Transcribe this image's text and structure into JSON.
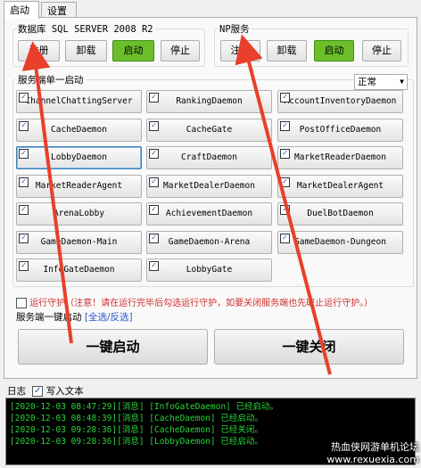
{
  "tabs": [
    "启动",
    "设置"
  ],
  "db_group": {
    "title": "数据库 SQL SERVER 2008 R2",
    "buttons": [
      "注册",
      "卸载",
      "启动",
      "停止"
    ]
  },
  "np_group": {
    "title": "NP服务",
    "buttons": [
      "注册",
      "卸载",
      "启动",
      "停止"
    ]
  },
  "services_group": {
    "title": "服务端单一启动",
    "mode_select": "正常",
    "services": [
      "ChannelChattingServer",
      "RankingDaemon",
      "AccountInventoryDaemon",
      "CacheDaemon",
      "CacheGate",
      "PostOfficeDaemon",
      "LobbyDaemon",
      "CraftDaemon",
      "MarketReaderDaemon",
      "MarketReaderAgent",
      "MarketDealerDaemon",
      "MarketDealerAgent",
      "ArenaLobby",
      "AchievementDaemon",
      "DuelBotDaemon",
      "GameDaemon-Main",
      "GameDaemon-Arena",
      "GameDaemon-Dungeon",
      "InfoGateDaemon",
      "LobbyGate"
    ]
  },
  "guard": {
    "label": "运行守护（注意！请在运行完毕后勾选运行守护，如要关闭服务端也先取止运行守护。）"
  },
  "oneclick": {
    "title": "服务端一键启动",
    "toggle_link": "[全选/反选]",
    "start": "一键启动",
    "stop": "一键关闭"
  },
  "log_header": {
    "label": "日志",
    "write_text": "写入文本"
  },
  "logs": [
    "[2020-12-03 08:47:29][消息] [InfoGateDaemon] 已经启动。",
    "[2020-12-03 08:48:39][消息] [CacheDaemon] 已经启动。",
    "[2020-12-03 09:28:36][消息] [CacheDaemon] 已经关闭。",
    "[2020-12-03 09:28:36][消息] [LobbyDaemon] 已经启动。"
  ],
  "watermark": {
    "line1": "热血侠网游单机论坛",
    "line2": "www.rexuexia.com"
  },
  "colors": {
    "accent_green": "#6cbf2b",
    "arrow_red": "#e8402a",
    "log_text": "#2bd33a"
  }
}
